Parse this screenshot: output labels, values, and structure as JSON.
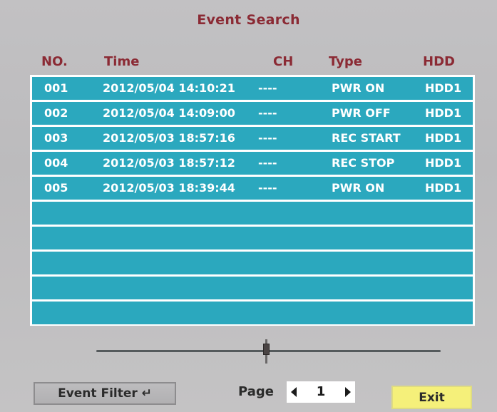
{
  "title": "Event Search",
  "columns": {
    "no": "NO.",
    "time": "Time",
    "ch": "CH",
    "type": "Type",
    "hdd": "HDD"
  },
  "events": [
    {
      "no": "001",
      "time": "2012/05/04 14:10:21",
      "ch": "----",
      "type": "PWR ON",
      "hdd": "HDD1"
    },
    {
      "no": "002",
      "time": "2012/05/04 14:09:00",
      "ch": "----",
      "type": "PWR OFF",
      "hdd": "HDD1"
    },
    {
      "no": "003",
      "time": "2012/05/03 18:57:16",
      "ch": "----",
      "type": "REC START",
      "hdd": "HDD1"
    },
    {
      "no": "004",
      "time": "2012/05/03 18:57:12",
      "ch": "----",
      "type": "REC STOP",
      "hdd": "HDD1"
    },
    {
      "no": "005",
      "time": "2012/05/03 18:39:44",
      "ch": "----",
      "type": "PWR ON",
      "hdd": "HDD1"
    },
    {
      "no": "",
      "time": "",
      "ch": "",
      "type": "",
      "hdd": ""
    },
    {
      "no": "",
      "time": "",
      "ch": "",
      "type": "",
      "hdd": ""
    },
    {
      "no": "",
      "time": "",
      "ch": "",
      "type": "",
      "hdd": ""
    },
    {
      "no": "",
      "time": "",
      "ch": "",
      "type": "",
      "hdd": ""
    },
    {
      "no": "",
      "time": "",
      "ch": "",
      "type": "",
      "hdd": ""
    }
  ],
  "footer": {
    "filter_label": "Event Filter ↵",
    "page_label": "Page",
    "page_number": "1",
    "exit_label": "Exit"
  },
  "colors": {
    "title": "#8b2a34",
    "row": "#2ba8be",
    "exit": "#f5f07a"
  },
  "icons": {
    "enter": "enter-icon",
    "prev": "prev-page-icon",
    "next": "next-page-icon"
  }
}
